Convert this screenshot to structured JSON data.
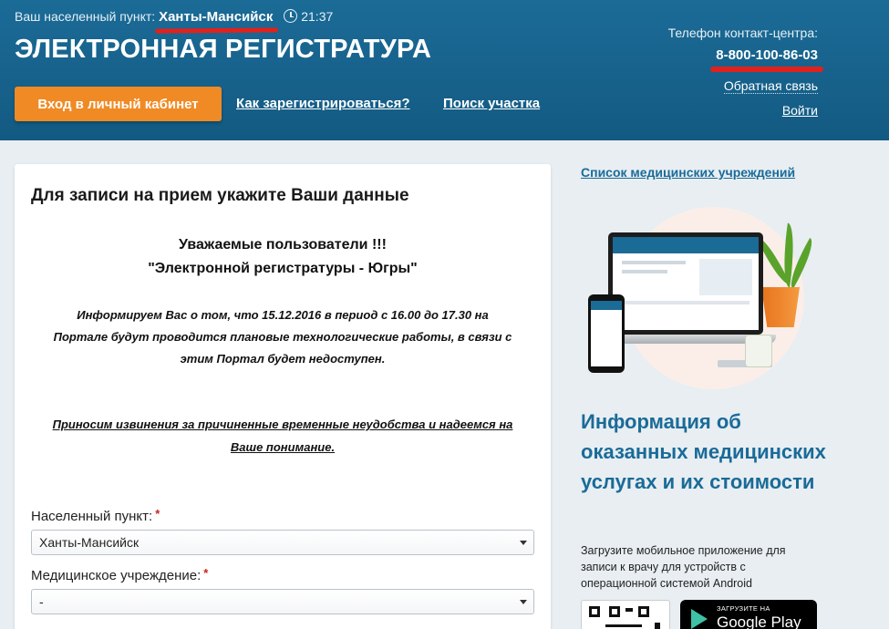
{
  "header": {
    "location_label": "Ваш населенный пункт:",
    "location_city": "Ханты-Мансийск",
    "time": "21:37",
    "site_title": "ЭЛЕКТРОННАЯ РЕГИСТРАТУРА",
    "login_button": "Вход в личный кабинет",
    "nav_register": "Как зарегистрироваться?",
    "nav_search": "Поиск участка",
    "phone_label": "Телефон контакт-центра:",
    "phone": "8-800-100-86-03",
    "feedback": "Обратная связь",
    "logout": "Войти"
  },
  "main": {
    "title": "Для записи на прием укажите Ваши данные",
    "notice_line1": "Уважаемые пользователи !!!",
    "notice_line2": "\"Электронной регистратуры - Югры\"",
    "info_line1": "Информируем Вас о том, что 15.12.2016  в период с 16.00 до 17.30 на",
    "info_line2": "Порталe будут проводится плановые технологические работы, в связи с",
    "info_line3": "этим Портал будет недоступен.",
    "apology_line1": "Приносим извинения за причиненные временные неудобства и надеемся на",
    "apology_line2": "Ваше понимание.",
    "city_label": "Населенный пункт:",
    "city_value": "Ханты-Мансийск",
    "institution_label": "Медицинское учреждение:",
    "institution_value": "-",
    "required_mark": "*"
  },
  "sidebar": {
    "institutions_link": "Список медицинских учреждений",
    "info_title": "Информация об оказанных медицинских услугах и их стоимости",
    "app_text": "Загрузите мобильное приложение для записи к врачу для устройств с операционной системой Android",
    "gplay_small": "ЗАГРУЗИТЕ НА",
    "gplay_big": "Google Play"
  },
  "colors": {
    "header_bg": "#1b6b97",
    "accent_orange": "#f08a24",
    "link_blue": "#1a6b98",
    "highlight_red": "#e2211c"
  }
}
